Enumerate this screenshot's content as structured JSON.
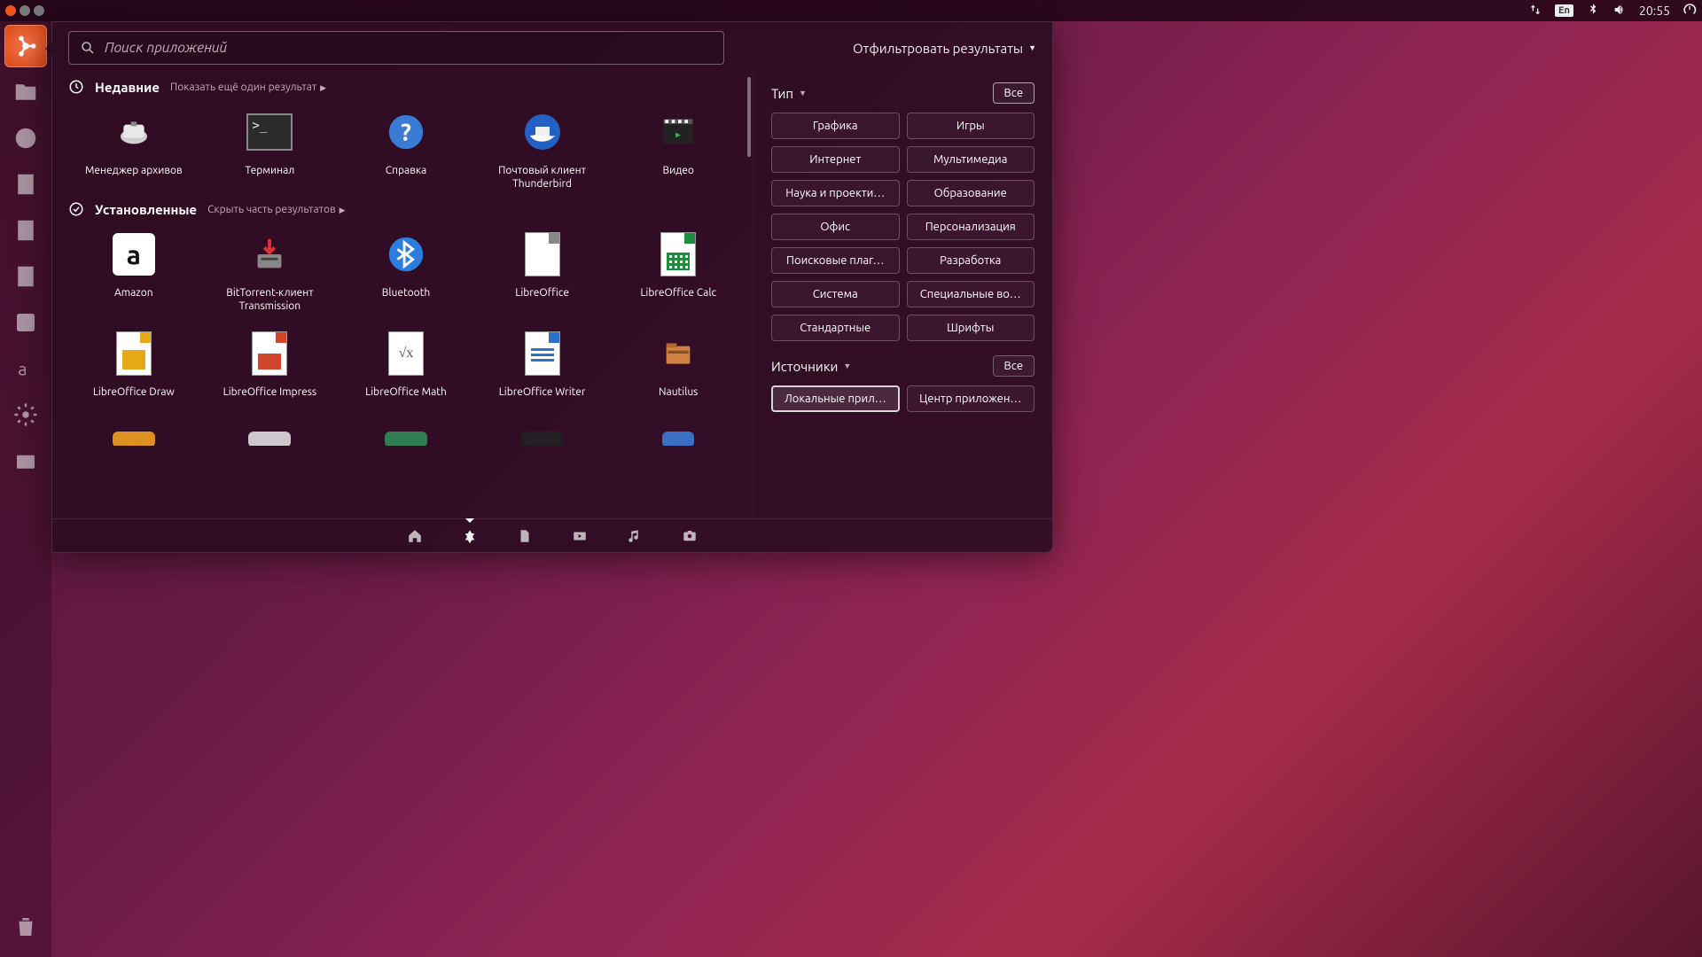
{
  "topbar": {
    "lang": "En",
    "time": "20:55"
  },
  "launcher": {
    "items": [
      "ubuntu",
      "files",
      "firefox",
      "writer",
      "calc",
      "impress",
      "software",
      "amazon",
      "settings",
      "backup"
    ],
    "trash": "trash"
  },
  "search": {
    "placeholder": "Поиск приложений"
  },
  "filter_link": "Отфильтровать результаты",
  "sections": {
    "recent": {
      "title": "Недавние",
      "more": "Показать ещё один результат"
    },
    "installed": {
      "title": "Установленные",
      "more": "Скрыть часть результатов"
    }
  },
  "recent_apps": [
    {
      "name": "Менеджер архивов",
      "icon": "archive"
    },
    {
      "name": "Терминал",
      "icon": "terminal"
    },
    {
      "name": "Справка",
      "icon": "help"
    },
    {
      "name": "Почтовый клиент Thunderbird",
      "icon": "thunderbird"
    },
    {
      "name": "Видео",
      "icon": "video"
    }
  ],
  "installed_apps": [
    {
      "name": "Amazon",
      "icon": "amazon"
    },
    {
      "name": "BitTorrent-клиент Transmission",
      "icon": "transmission"
    },
    {
      "name": "Bluetooth",
      "icon": "bluetooth"
    },
    {
      "name": "LibreOffice",
      "icon": "libreoffice"
    },
    {
      "name": "LibreOffice Calc",
      "icon": "calc"
    },
    {
      "name": "LibreOffice Draw",
      "icon": "draw"
    },
    {
      "name": "LibreOffice Impress",
      "icon": "impress"
    },
    {
      "name": "LibreOffice Math",
      "icon": "math"
    },
    {
      "name": "LibreOffice Writer",
      "icon": "writer"
    },
    {
      "name": "Nautilus",
      "icon": "nautilus"
    }
  ],
  "filters": {
    "type": {
      "label": "Тип",
      "all": "Все",
      "chips": [
        "Графика",
        "Игры",
        "Интернет",
        "Мультимедиа",
        "Наука и проекти…",
        "Образование",
        "Офис",
        "Персонализация",
        "Поисковые плаг…",
        "Разработка",
        "Система",
        "Специальные во…",
        "Стандартные",
        "Шрифты"
      ]
    },
    "sources": {
      "label": "Источники",
      "all": "Все",
      "chips": [
        "Локальные прил…",
        "Центр приложен…"
      ],
      "selected": 0
    }
  },
  "lenses": [
    "home",
    "apps",
    "files",
    "video",
    "music",
    "photos"
  ]
}
